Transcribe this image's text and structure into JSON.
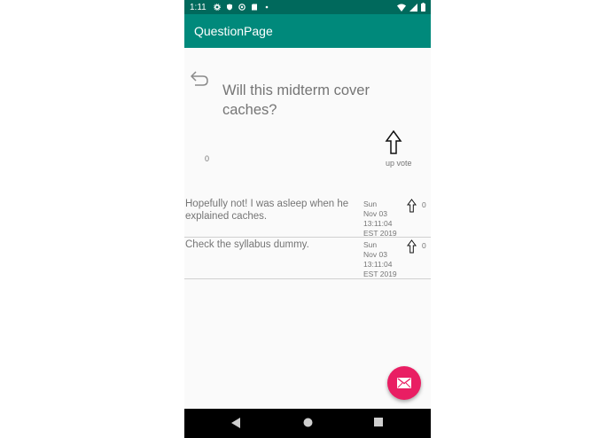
{
  "status_bar": {
    "time": "1:11",
    "icons": [
      "gear-icon",
      "shield-icon",
      "sync-icon",
      "sd-card-icon",
      "dot-icon"
    ],
    "right_icons": [
      "wifi-icon",
      "signal-icon",
      "battery-icon"
    ]
  },
  "app_bar": {
    "title": "QuestionPage"
  },
  "question": {
    "title": "Will this midterm cover caches?",
    "vote_count": "0",
    "upvote_label": "up vote"
  },
  "answers": [
    {
      "text": "Hopefully not! I was asleep when he explained caches.",
      "date_lines": [
        "Sun",
        "Nov 03",
        "13:11:04",
        "EST 2019"
      ],
      "votes": "0"
    },
    {
      "text": "Check the syllabus dummy.",
      "date_lines": [
        "Sun",
        "Nov 03",
        "13:11:04",
        "EST 2019"
      ],
      "votes": "0"
    }
  ],
  "fab": {
    "icon": "mail-icon",
    "color": "#e91e63"
  },
  "nav_bar": {
    "buttons": [
      "back-icon",
      "home-icon",
      "recents-icon"
    ]
  },
  "colors": {
    "status_bar": "#00695c",
    "app_bar": "#00897b",
    "accent": "#e91e63"
  }
}
